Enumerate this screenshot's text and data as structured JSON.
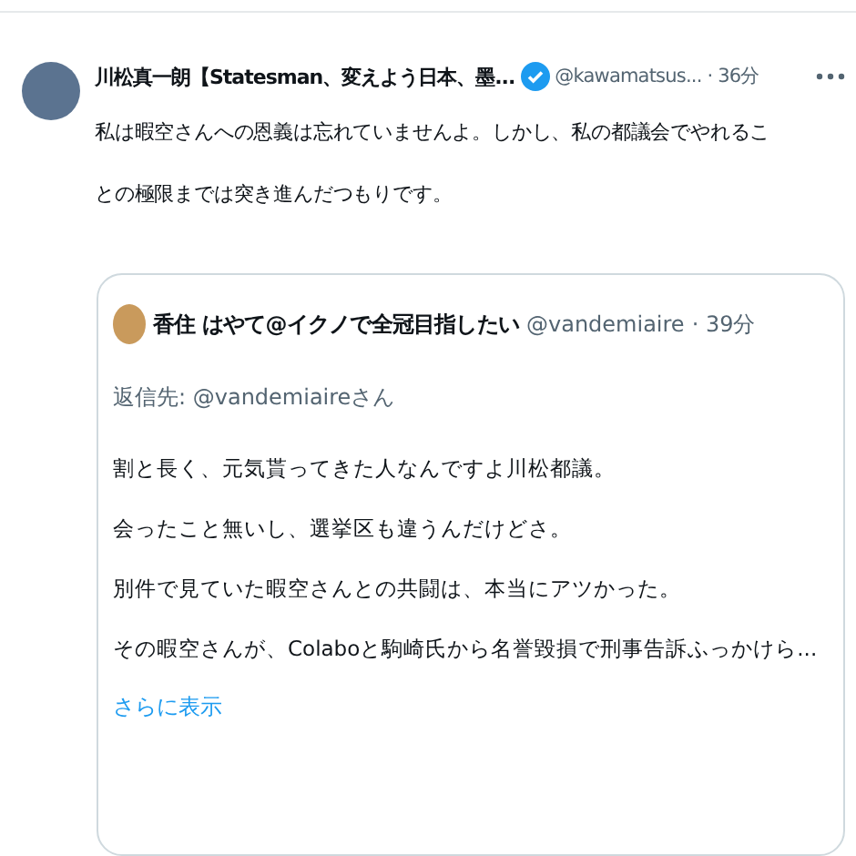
{
  "tweet": {
    "author_name": "川松真一朗【Statesman、変えよう日本、墨...",
    "verified": true,
    "handle": "@kawamatsus...",
    "time": "· 36分",
    "text_lines": [
      "私は暇空さんへの恩義は忘れていませんよ。しかし、私の都議会でやれるこ",
      "との極限までは突き進んだつもりです。"
    ],
    "quote": {
      "author_name": "香住 はやて@イクノで全冠目指したい",
      "handle": "@vandemiaire",
      "time": "· 39分",
      "reply_to": "返信先: @vandemiaireさん",
      "text_lines": [
        "割と長く、元気貰ってきた人なんですよ川松都議。",
        "会ったこと無いし、選挙区も違うんだけどさ。",
        "別件で見ていた暇空さんとの共闘は、本当にアツかった。",
        "その暇空さんが、Colaboと駒崎氏から名誉毀損で刑事告訴ふっかけら..."
      ],
      "show_more": "さらに表示"
    }
  }
}
